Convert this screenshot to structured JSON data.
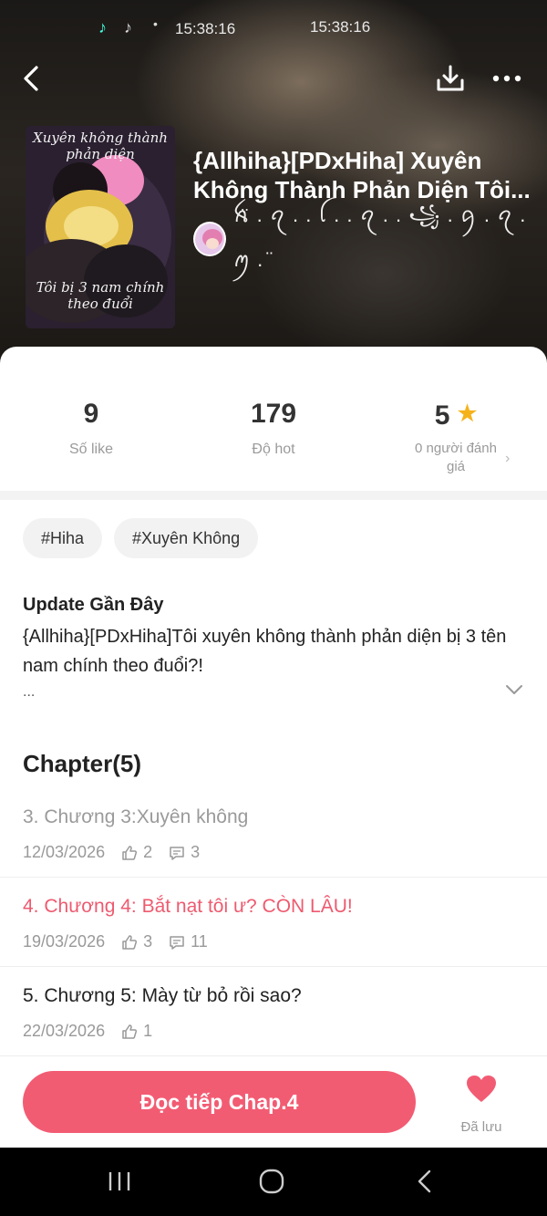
{
  "status_bar": {
    "time_left": "15:38:16",
    "time_center": "15:38:16",
    "icons": [
      "tiktok-icon",
      "tiktok-icon",
      "dot-icon"
    ]
  },
  "header": {
    "back_icon": "chevron-left-icon",
    "download_icon": "download-icon",
    "more_icon": "more-icon"
  },
  "book": {
    "title_line1": "{Allhiha}[PDxHiha] Xuyên",
    "title_line2": "Không Thành Phản Diện Tôi...",
    "author": "ꫝ̈ . ꪖ . . ꪶ . . ꪖ . . ꧁ . ꪇ . ꪖ . ꪑ . ̈",
    "cover_text_top": "Xuyên không thành phản diện",
    "cover_text_bottom": "Tôi bị 3 nam chính theo đuổi"
  },
  "stats": {
    "likes": "9",
    "likes_label": "Số like",
    "hot": "179",
    "hot_label": "Độ hot",
    "rating": "5",
    "rating_label": "0 người đánh giá"
  },
  "tags": [
    "#Hiha",
    "#Xuyên Không"
  ],
  "update": {
    "title": "Update Gần Đây",
    "text": "{Allhiha}[PDxHiha]Tôi xuyên không thành phản diện bị 3 tên nam chính theo đuổi?!",
    "ellipsis": "..."
  },
  "chapters": {
    "header": "Chapter(5)",
    "items": [
      {
        "title": "3. Chương 3:Xuyên không",
        "date": "12/03/2026",
        "likes": "2",
        "comments": "3",
        "state": "read"
      },
      {
        "title": "4. Chương 4: Bắt nạt tôi ư? CÒN LÂU!",
        "date": "19/03/2026",
        "likes": "3",
        "comments": "11",
        "state": "current"
      },
      {
        "title": "5. Chương 5: Mày từ bỏ rồi sao?",
        "date": "22/03/2026",
        "likes": "1",
        "comments": "",
        "state": "unread"
      }
    ]
  },
  "actions": {
    "continue_label": "Đọc tiếp Chap.4",
    "saved_label": "Đã lưu"
  },
  "colors": {
    "accent": "#f25c73",
    "current_chapter": "#ee5a6f",
    "star": "#f5b21a"
  }
}
